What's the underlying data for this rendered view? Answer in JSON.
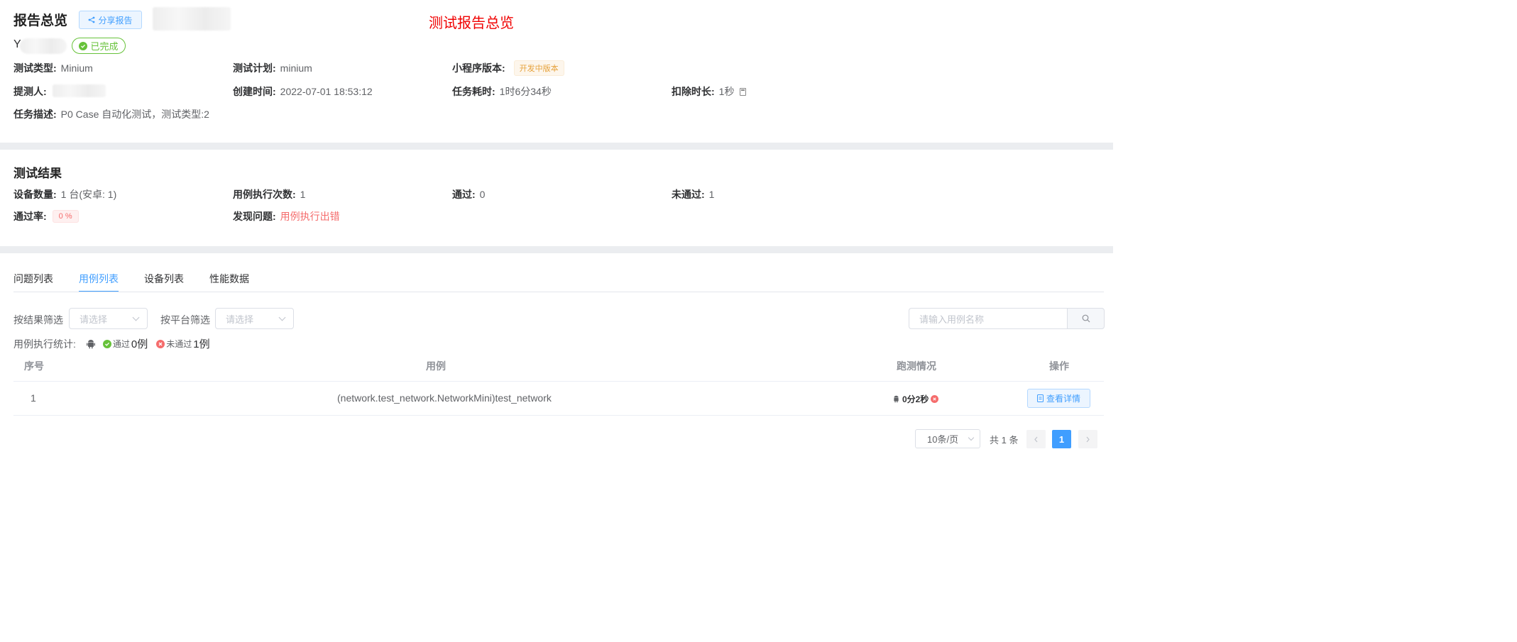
{
  "header": {
    "title": "报告总览",
    "share_label": "分享报告",
    "overview_label": "测试报告总览",
    "project_initial": "Y",
    "status": "已完成"
  },
  "info": {
    "test_type_k": "测试类型:",
    "test_type_v": "Minium",
    "test_plan_k": "测试计划:",
    "test_plan_v": "minium",
    "mp_version_k": "小程序版本:",
    "mp_version_v": "开发中版本",
    "tester_k": "提测人:",
    "created_k": "创建时间:",
    "created_v": "2022-07-01 18:53:12",
    "duration_k": "任务耗时:",
    "duration_v": "1时6分34秒",
    "deduct_k": "扣除时长:",
    "deduct_v": "1秒",
    "desc_k": "任务描述:",
    "desc_v": "P0 Case 自动化测试，测试类型:2"
  },
  "results": {
    "title": "测试结果",
    "devices_k": "设备数量:",
    "devices_v": "1 台(安卓: 1)",
    "runs_k": "用例执行次数:",
    "runs_v": "1",
    "pass_k": "通过:",
    "pass_v": "0",
    "fail_k": "未通过:",
    "fail_v": "1",
    "rate_k": "通过率:",
    "rate_v": "0 %",
    "issue_k": "发现问题:",
    "issue_v": "用例执行出错"
  },
  "tabs": [
    "问题列表",
    "用例列表",
    "设备列表",
    "性能数据"
  ],
  "active_tab": 1,
  "filters": {
    "result_label": "按结果筛选",
    "result_placeholder": "请选择",
    "platform_label": "按平台筛选",
    "platform_placeholder": "请选择",
    "search_placeholder": "请输入用例名称"
  },
  "stats": {
    "label": "用例执行统计:",
    "pass_label": "通过",
    "pass_count": "0例",
    "fail_label": "未通过",
    "fail_count": "1例"
  },
  "table": {
    "headers": [
      "序号",
      "用例",
      "跑测情况",
      "操作"
    ],
    "rows": [
      {
        "index": "1",
        "case": "(network.test_network.NetworkMini)test_network",
        "run_time": "0分2秒",
        "action": "查看详情"
      }
    ]
  },
  "pagination": {
    "page_size": "10条/页",
    "total": "共 1 条",
    "current": "1"
  },
  "colors": {
    "primary": "#409eff",
    "success": "#67c23a",
    "danger": "#f56c6c",
    "warning": "#e6a23c",
    "highlight_red": "#f00000"
  }
}
